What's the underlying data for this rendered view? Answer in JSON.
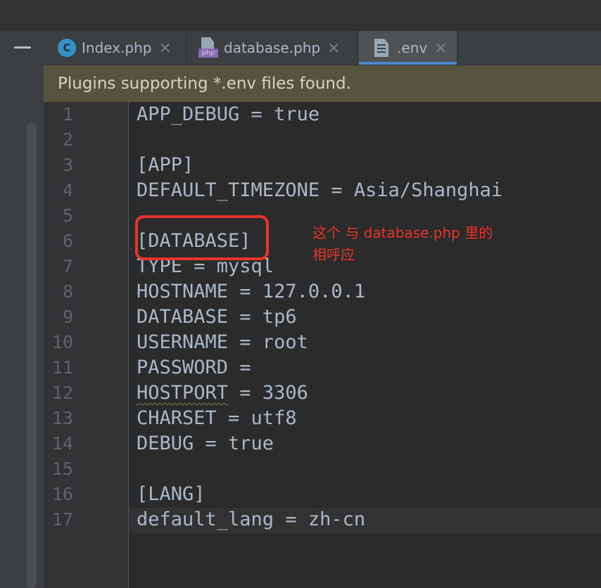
{
  "tabs": [
    {
      "label": "Index.php",
      "icon": "class-c-icon",
      "active": false
    },
    {
      "label": "database.php",
      "icon": "php-file-icon",
      "active": false
    },
    {
      "label": ".env",
      "icon": "text-file-icon",
      "active": true
    }
  ],
  "tab_close": "×",
  "notification": "Plugins supporting *.env files found.",
  "editor": {
    "line_numbers": [
      "1",
      "2",
      "3",
      "4",
      "5",
      "6",
      "7",
      "8",
      "9",
      "10",
      "11",
      "12",
      "13",
      "14",
      "15",
      "16",
      "17"
    ],
    "lines": [
      "APP_DEBUG = true",
      "",
      "[APP]",
      "DEFAULT_TIMEZONE = Asia/Shanghai",
      "",
      "[DATABASE]",
      "TYPE = mysql",
      "HOSTNAME = 127.0.0.1",
      "DATABASE = tp6",
      "USERNAME = root",
      "PASSWORD =",
      "HOSTPORT = 3306",
      "CHARSET = utf8",
      "DEBUG = true",
      "",
      "[LANG]",
      "default_lang = zh-cn"
    ],
    "hostport_key": "HOSTPORT",
    "hostport_rest": " = 3306"
  },
  "annotation": {
    "line1": "这个 与 database.php 里的",
    "line2": "相呼应",
    "color": "#e8342a"
  },
  "colors": {
    "editor_bg": "#2b2b2b",
    "text": "#a9b7c6",
    "banner_bg": "#54543f",
    "active_tab_underline": "#4a88c7"
  }
}
